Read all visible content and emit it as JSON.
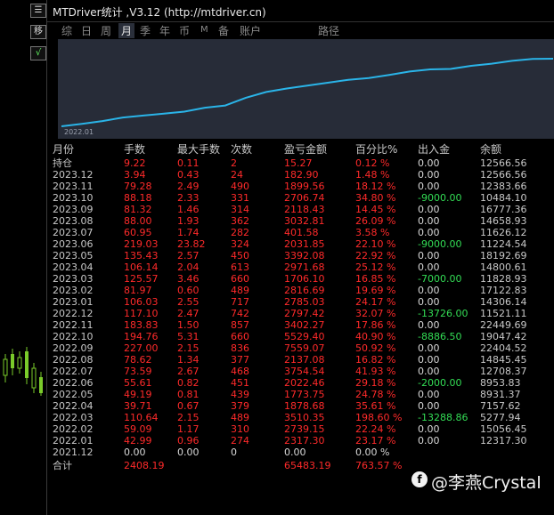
{
  "left_panel": {
    "buttons": [
      "☰",
      "移",
      "√"
    ]
  },
  "window": {
    "title": "MTDriver统计 ,V3.12 (http://mtdriver.cn)"
  },
  "tabs": [
    {
      "label": "综"
    },
    {
      "label": "日"
    },
    {
      "label": "周"
    },
    {
      "label": "月",
      "active": true
    },
    {
      "label": "季"
    },
    {
      "label": "年"
    },
    {
      "label": "币"
    },
    {
      "label": "M"
    },
    {
      "label": "备"
    },
    {
      "label": "账户"
    },
    {
      "label": "路径"
    }
  ],
  "chart": {
    "start_label": "2022.01",
    "line_color": "#2ab4e8",
    "background": "#272c38"
  },
  "chart_data": {
    "type": "line",
    "x": [
      "2022.01",
      "2022.02",
      "2022.03",
      "2022.04",
      "2022.05",
      "2022.06",
      "2022.07",
      "2022.08",
      "2022.09",
      "2022.10",
      "2022.11",
      "2022.12",
      "2023.01",
      "2023.02",
      "2023.03",
      "2023.04",
      "2023.05",
      "2023.06",
      "2023.07",
      "2023.08",
      "2023.09",
      "2023.10",
      "2023.11",
      "2023.12"
    ],
    "series": [
      {
        "values": [
          2317.3,
          5056.45,
          8566.8,
          10445.48,
          12218.23,
          14240.69,
          17995.23,
          20132.31,
          27691.59,
          33221.19,
          36623.46,
          39420.88,
          42206.07,
          45022.76,
          46728.86,
          49700.54,
          53092.74,
          55124.59,
          55526.17,
          58558.98,
          60677.41,
          63384.15,
          65283.71,
          65466.61
        ]
      }
    ]
  },
  "table": {
    "headers": {
      "month": "月份",
      "lots": "手数",
      "max_lots": "最大手数",
      "count": "次数",
      "pnl": "盈亏金额",
      "pct": "百分比%",
      "io": "出入金",
      "balance": "余额"
    },
    "rows": [
      {
        "month": "持仓",
        "lots": "9.22",
        "max_lots": "0.11",
        "count": "2",
        "pnl": "15.27",
        "pct": "0.12 %",
        "io": "0.00",
        "balance": "12566.56"
      },
      {
        "month": "2023.12",
        "lots": "3.94",
        "max_lots": "0.43",
        "count": "24",
        "pnl": "182.90",
        "pct": "1.48 %",
        "io": "0.00",
        "balance": "12566.56"
      },
      {
        "month": "2023.11",
        "lots": "79.28",
        "max_lots": "2.49",
        "count": "490",
        "pnl": "1899.56",
        "pct": "18.12 %",
        "io": "0.00",
        "balance": "12383.66"
      },
      {
        "month": "2023.10",
        "lots": "88.18",
        "max_lots": "2.33",
        "count": "331",
        "pnl": "2706.74",
        "pct": "34.80 %",
        "io": "-9000.00",
        "balance": "10484.10"
      },
      {
        "month": "2023.09",
        "lots": "81.32",
        "max_lots": "1.46",
        "count": "314",
        "pnl": "2118.43",
        "pct": "14.45 %",
        "io": "0.00",
        "balance": "16777.36"
      },
      {
        "month": "2023.08",
        "lots": "88.00",
        "max_lots": "1.93",
        "count": "362",
        "pnl": "3032.81",
        "pct": "26.09 %",
        "io": "0.00",
        "balance": "14658.93"
      },
      {
        "month": "2023.07",
        "lots": "60.95",
        "max_lots": "1.74",
        "count": "282",
        "pnl": "401.58",
        "pct": "3.58 %",
        "io": "0.00",
        "balance": "11626.12"
      },
      {
        "month": "2023.06",
        "lots": "219.03",
        "max_lots": "23.82",
        "count": "324",
        "pnl": "2031.85",
        "pct": "22.10 %",
        "io": "-9000.00",
        "balance": "11224.54"
      },
      {
        "month": "2023.05",
        "lots": "135.43",
        "max_lots": "2.57",
        "count": "450",
        "pnl": "3392.08",
        "pct": "22.92 %",
        "io": "0.00",
        "balance": "18192.69"
      },
      {
        "month": "2023.04",
        "lots": "106.14",
        "max_lots": "2.04",
        "count": "613",
        "pnl": "2971.68",
        "pct": "25.12 %",
        "io": "0.00",
        "balance": "14800.61"
      },
      {
        "month": "2023.03",
        "lots": "125.57",
        "max_lots": "3.46",
        "count": "660",
        "pnl": "1706.10",
        "pct": "16.85 %",
        "io": "-7000.00",
        "balance": "11828.93"
      },
      {
        "month": "2023.02",
        "lots": "81.97",
        "max_lots": "0.60",
        "count": "489",
        "pnl": "2816.69",
        "pct": "19.69 %",
        "io": "0.00",
        "balance": "17122.83"
      },
      {
        "month": "2023.01",
        "lots": "106.03",
        "max_lots": "2.55",
        "count": "717",
        "pnl": "2785.03",
        "pct": "24.17 %",
        "io": "0.00",
        "balance": "14306.14"
      },
      {
        "month": "2022.12",
        "lots": "117.10",
        "max_lots": "2.47",
        "count": "742",
        "pnl": "2797.42",
        "pct": "32.07 %",
        "io": "-13726.00",
        "balance": "11521.11"
      },
      {
        "month": "2022.11",
        "lots": "183.83",
        "max_lots": "1.50",
        "count": "857",
        "pnl": "3402.27",
        "pct": "17.86 %",
        "io": "0.00",
        "balance": "22449.69"
      },
      {
        "month": "2022.10",
        "lots": "194.76",
        "max_lots": "5.31",
        "count": "660",
        "pnl": "5529.40",
        "pct": "40.90 %",
        "io": "-8886.50",
        "balance": "19047.42"
      },
      {
        "month": "2022.09",
        "lots": "227.00",
        "max_lots": "2.15",
        "count": "836",
        "pnl": "7559.07",
        "pct": "50.92 %",
        "io": "0.00",
        "balance": "22404.52"
      },
      {
        "month": "2022.08",
        "lots": "78.62",
        "max_lots": "1.34",
        "count": "377",
        "pnl": "2137.08",
        "pct": "16.82 %",
        "io": "0.00",
        "balance": "14845.45"
      },
      {
        "month": "2022.07",
        "lots": "73.59",
        "max_lots": "2.67",
        "count": "468",
        "pnl": "3754.54",
        "pct": "41.93 %",
        "io": "0.00",
        "balance": "12708.37"
      },
      {
        "month": "2022.06",
        "lots": "55.61",
        "max_lots": "0.82",
        "count": "451",
        "pnl": "2022.46",
        "pct": "29.18 %",
        "io": "-2000.00",
        "balance": "8953.83"
      },
      {
        "month": "2022.05",
        "lots": "49.19",
        "max_lots": "0.81",
        "count": "439",
        "pnl": "1773.75",
        "pct": "24.78 %",
        "io": "0.00",
        "balance": "8931.37"
      },
      {
        "month": "2022.04",
        "lots": "39.71",
        "max_lots": "0.67",
        "count": "379",
        "pnl": "1878.68",
        "pct": "35.61 %",
        "io": "0.00",
        "balance": "7157.62"
      },
      {
        "month": "2022.03",
        "lots": "110.64",
        "max_lots": "2.15",
        "count": "489",
        "pnl": "3510.35",
        "pct": "198.60 %",
        "io": "-13288.86",
        "balance": "5277.94"
      },
      {
        "month": "2022.02",
        "lots": "59.09",
        "max_lots": "1.17",
        "count": "310",
        "pnl": "2739.15",
        "pct": "22.24 %",
        "io": "0.00",
        "balance": "15056.45"
      },
      {
        "month": "2022.01",
        "lots": "42.99",
        "max_lots": "0.96",
        "count": "274",
        "pnl": "2317.30",
        "pct": "23.17 %",
        "io": "0.00",
        "balance": "12317.30"
      },
      {
        "month": "2021.12",
        "lots": "0.00",
        "max_lots": "0.00",
        "count": "0",
        "pnl": "0.00",
        "pct": "0.00 %",
        "io": "",
        "balance": ""
      }
    ],
    "total": {
      "month": "合计",
      "lots": "2408.19",
      "pnl": "65483.19",
      "pct": "763.57 %"
    }
  },
  "watermark": {
    "logo": "f",
    "text": "@李燕Crystal"
  },
  "colors": {
    "positive": "#ff2a2a",
    "neutral": "#d8d8d8",
    "withdrawal": "#33dd55"
  }
}
